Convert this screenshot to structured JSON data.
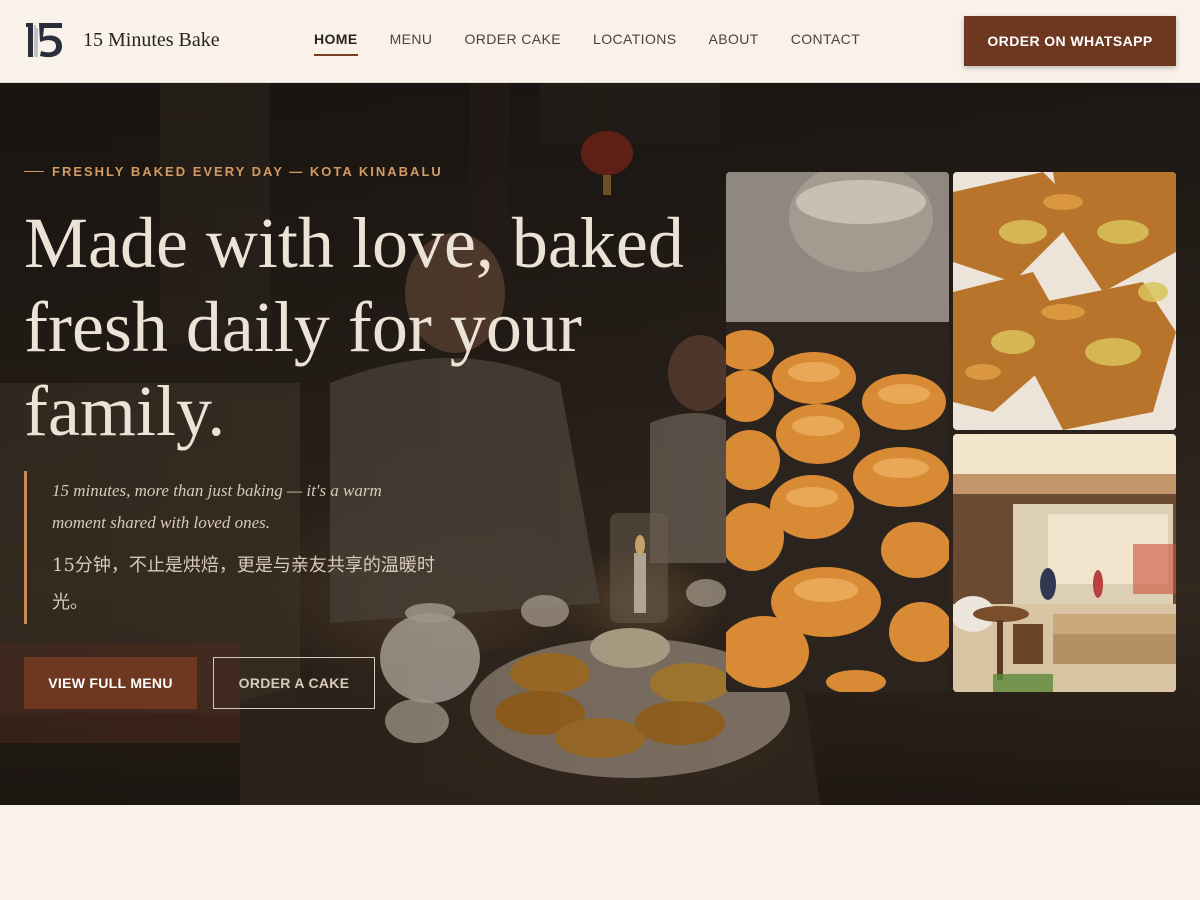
{
  "brand": {
    "logo_mark": "15",
    "name": "15 Minutes Bake"
  },
  "nav": {
    "items": [
      {
        "label": "HOME",
        "active": true
      },
      {
        "label": "MENU",
        "active": false
      },
      {
        "label": "ORDER CAKE",
        "active": false
      },
      {
        "label": "LOCATIONS",
        "active": false
      },
      {
        "label": "ABOUT",
        "active": false
      },
      {
        "label": "CONTACT",
        "active": false
      }
    ],
    "cta_label": "ORDER ON WHATSAPP"
  },
  "hero": {
    "eyebrow": "FRESHLY BAKED EVERY DAY — KOTA KINABALU",
    "headline": "Made with love, baked fresh daily for your family.",
    "quote_en": "15 minutes, more than just baking — it's a warm moment shared with loved ones.",
    "quote_zh": "15分钟，不止是烘焙，更是与亲友共享的温暖时光。",
    "primary_button": "VIEW FULL MENU",
    "secondary_button": "ORDER A CAKE"
  },
  "colors": {
    "accent": "#6e3720",
    "eyebrow": "#d49a62",
    "background": "#f8f2ea"
  }
}
